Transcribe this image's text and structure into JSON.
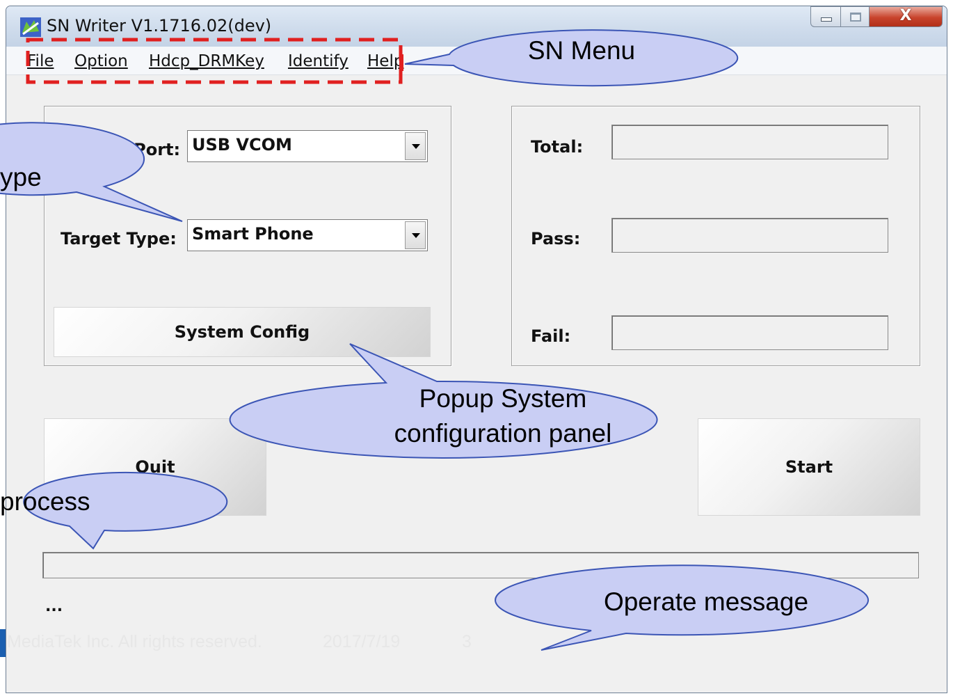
{
  "window": {
    "title": "SN Writer V1.1716.02(dev)",
    "close_glyph": "X"
  },
  "menu": {
    "items": [
      "File",
      "Option",
      "Hdcp_DRMKey",
      "Identify",
      "Help"
    ]
  },
  "settings": {
    "comport_label": "ComPort:",
    "comport_value": "USB VCOM",
    "target_label": "Target Type:",
    "target_value": "Smart Phone",
    "config_button": "System Config"
  },
  "stats": {
    "total_label": "Total:",
    "pass_label": "Pass:",
    "fail_label": "Fail:",
    "total_value": "",
    "pass_value": "",
    "fail_value": ""
  },
  "actions": {
    "quit_label": "Quit",
    "start_label": "Start"
  },
  "status": {
    "message": "..."
  },
  "callouts": {
    "menu": "SN Menu",
    "type": "ype",
    "config_line1": "Popup System",
    "config_line2": "configuration panel",
    "process": "process",
    "operate": "Operate message"
  },
  "footer": {
    "copyright": "MediaTek Inc. All rights reserved.",
    "date": "2017/7/19",
    "page": "3"
  },
  "colors": {
    "callout_fill": "#c9cef4",
    "callout_stroke": "#3b55b5",
    "highlight_dash": "#e02020"
  }
}
